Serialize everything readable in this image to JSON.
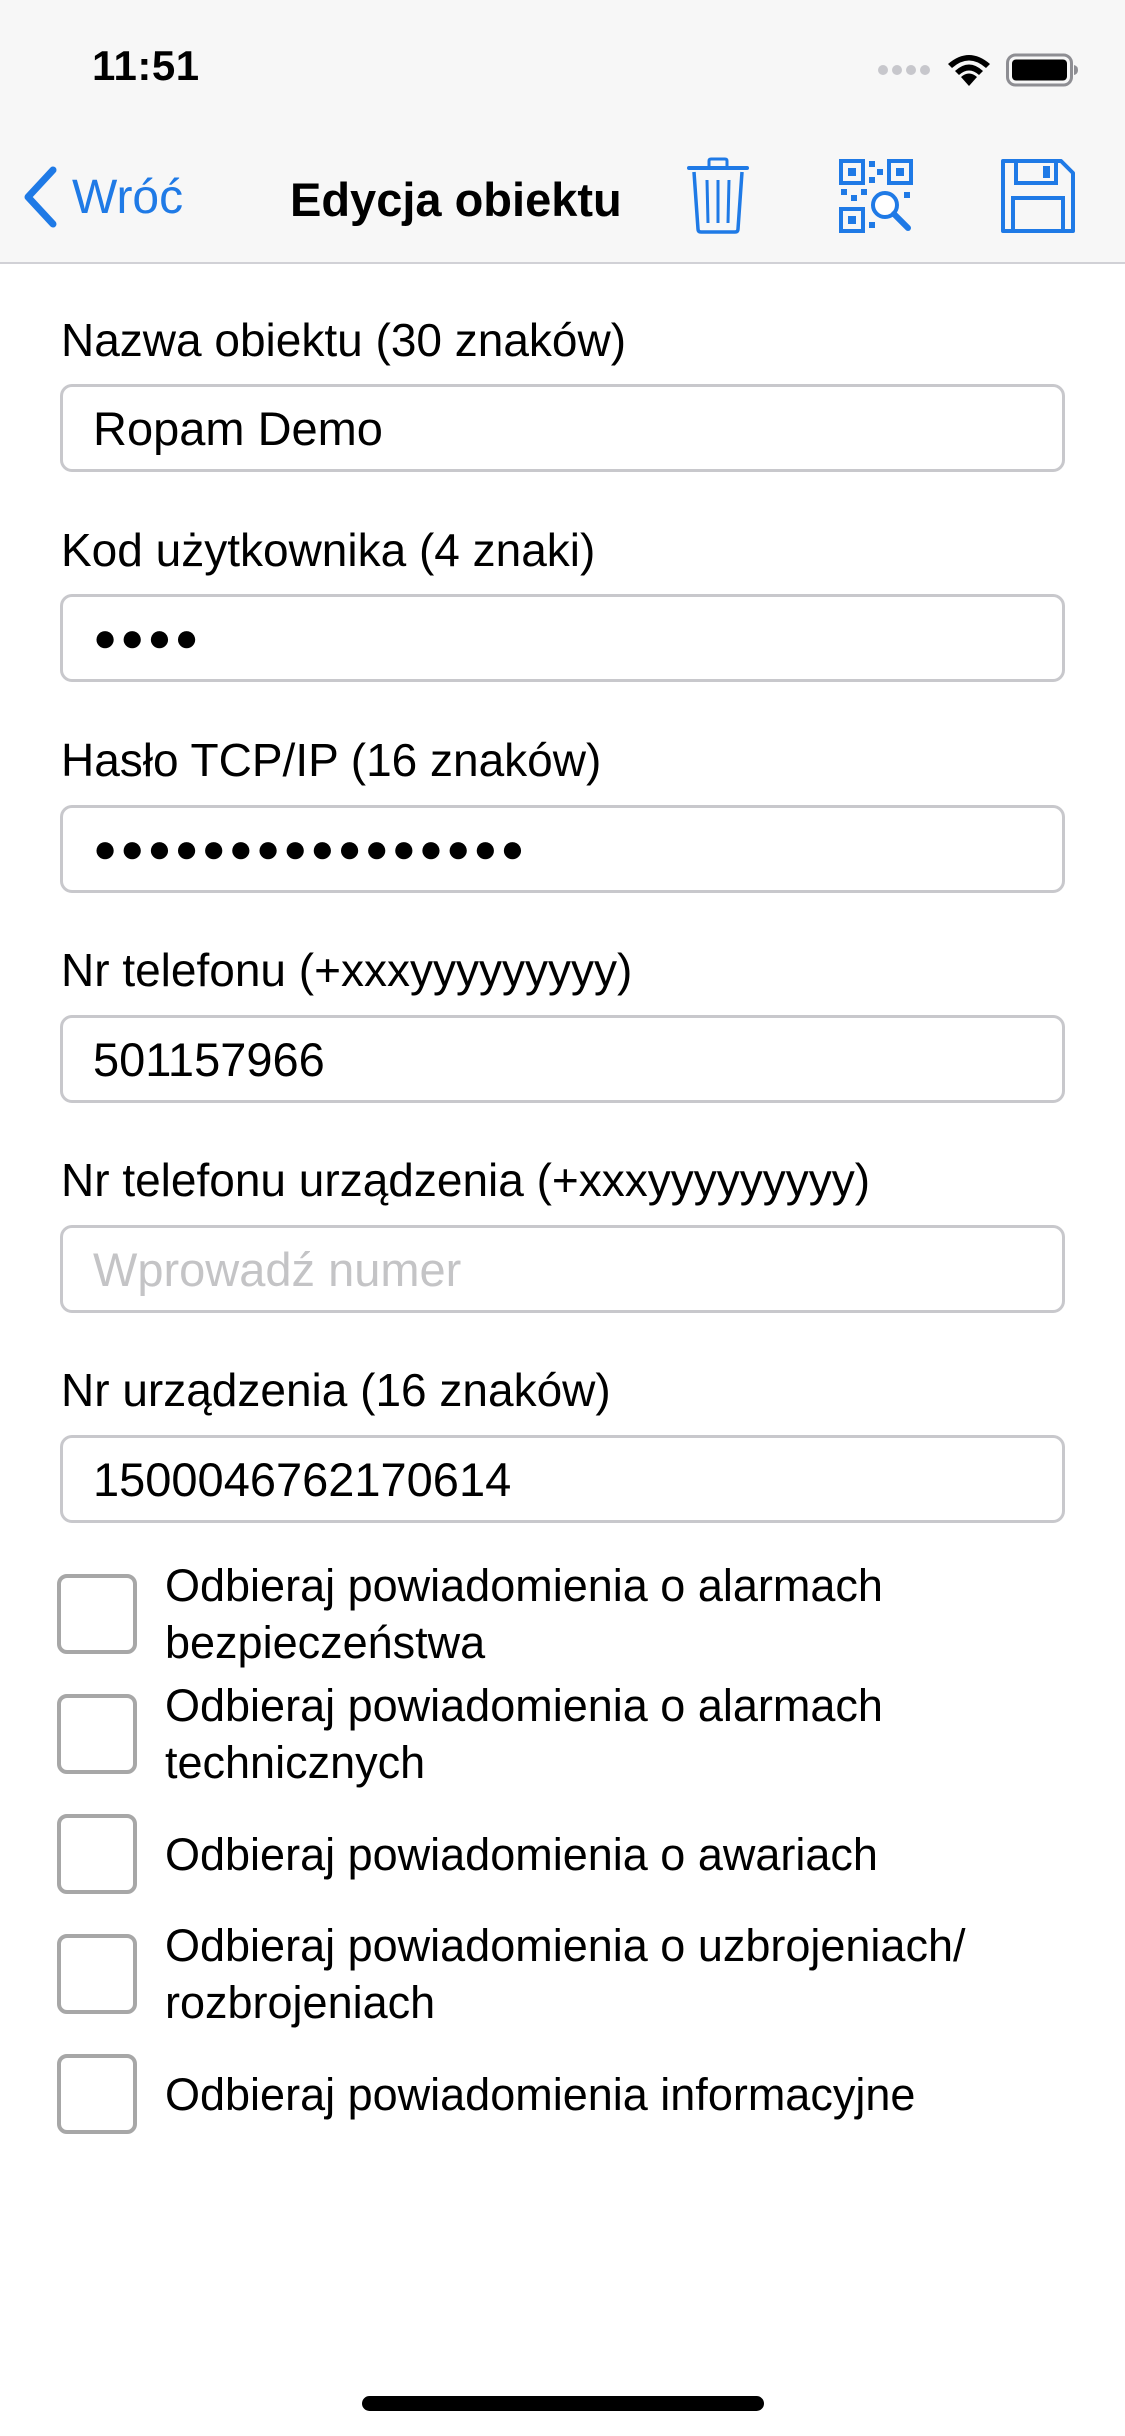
{
  "status_bar": {
    "time": "11:51"
  },
  "nav": {
    "back_label": "Wróć",
    "title": "Edycja obiektu",
    "accent_color": "#1f7ae6",
    "icons": [
      "trash-icon",
      "qr-scan-icon",
      "save-floppy-icon"
    ]
  },
  "form": {
    "fields": [
      {
        "label": "Nazwa obiektu (30 znaków)",
        "value": "Ropam Demo",
        "placeholder": ""
      },
      {
        "label": "Kod użytkownika (4 znaki)",
        "value": "●●●●",
        "placeholder": ""
      },
      {
        "label": "Hasło TCP/IP (16 znaków)",
        "value": "●●●●●●●●●●●●●●●●",
        "placeholder": ""
      },
      {
        "label": "Nr telefonu (+xxxyyyyyyyyy)",
        "value": "501157966",
        "placeholder": ""
      },
      {
        "label": "Nr telefonu urządzenia (+xxxyyyyyyyyy)",
        "value": "",
        "placeholder": "Wprowadź numer"
      },
      {
        "label": "Nr urządzenia (16 znaków)",
        "value": "1500046762170614",
        "placeholder": ""
      }
    ],
    "checkboxes": [
      {
        "label": "Odbieraj powiadomienia o alarmach bezpieczeństwa",
        "checked": false
      },
      {
        "label": "Odbieraj powiadomienia o alarmach technicznych",
        "checked": false
      },
      {
        "label": "Odbieraj powiadomienia o awariach",
        "checked": false
      },
      {
        "label": "Odbieraj powiadomienia o uzbrojeniach/ rozbrojeniach",
        "checked": false
      },
      {
        "label": "Odbieraj powiadomienia informacyjne",
        "checked": false
      }
    ]
  }
}
